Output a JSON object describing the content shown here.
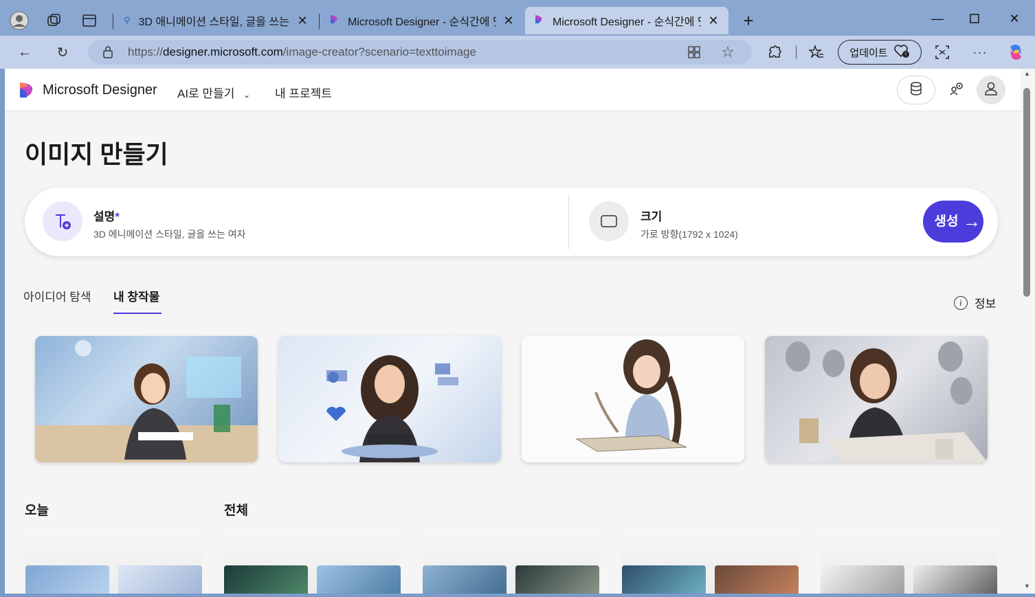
{
  "browser": {
    "tabs": [
      {
        "title": "3D 애니메이션 스타일, 글을 쓰는",
        "icon": "search-icon"
      },
      {
        "title": "Microsoft Designer - 순식간에 멋",
        "icon": "designer-logo-icon"
      },
      {
        "title": "Microsoft Designer - 순식간에 멋",
        "icon": "designer-logo-icon"
      }
    ],
    "url_prefix": "https://",
    "url_host": "designer.microsoft.com",
    "url_path": "/image-creator?scenario=texttoimage",
    "update_label": "업데이트"
  },
  "app": {
    "brand": "Microsoft Designer",
    "menu_ai": "AI로 만들기",
    "menu_projects": "내 프로젝트"
  },
  "page": {
    "title": "이미지 만들기",
    "description_label": "설명",
    "description_required": "*",
    "description_value": "3D 에니메이션 스타일, 글을 쓰는 여자",
    "size_label": "크기",
    "size_value": "가로 방향(1792 x 1024)",
    "generate_label": "생성",
    "tab_explore": "아이디어 탐색",
    "tab_mine": "내 창작물",
    "info_label": "정보",
    "section_today": "오늘",
    "section_all": "전체"
  },
  "colors": {
    "accent": "#4b3cdb",
    "browser_frame": "#8aa7d1",
    "active_tab": "#c3d2ea"
  }
}
